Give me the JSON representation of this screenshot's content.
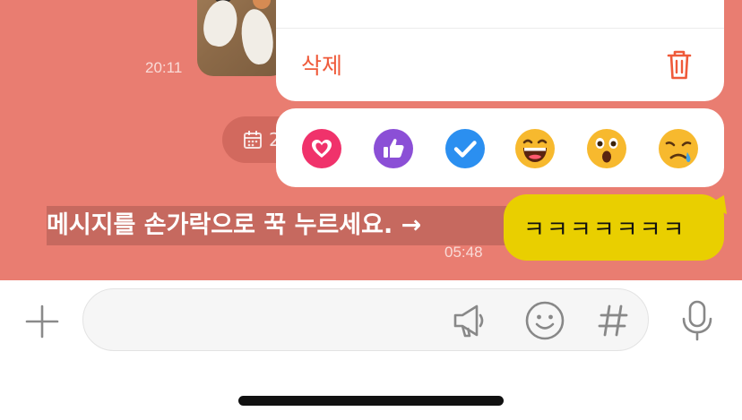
{
  "chat": {
    "time_photo": "20:11",
    "time_bubble": "05:48",
    "date_chip_visible": "2"
  },
  "context_menu": {
    "delete_label": "삭제",
    "delete_icon": "trash-icon",
    "accent": "#ef5a3a"
  },
  "reactions": [
    {
      "name": "heart-reaction-icon",
      "color": "#f0326b"
    },
    {
      "name": "thumbs-up-reaction-icon",
      "color": "#8b4fd6"
    },
    {
      "name": "check-reaction-icon",
      "color": "#2b8ff0"
    },
    {
      "name": "grin-emoji-icon",
      "color": "#f7b92e"
    },
    {
      "name": "surprised-emoji-icon",
      "color": "#f7b92e"
    },
    {
      "name": "sad-emoji-icon",
      "color": "#f7b92e"
    }
  ],
  "tutorial": {
    "text": "메시지를 손가락으로 꾹 누르세요.",
    "arrow": "→"
  },
  "message": {
    "text": "ㅋㅋㅋㅋㅋㅋㅋ",
    "bubble_color": "#e9cf00"
  },
  "input_bar": {
    "placeholder": "",
    "icons": [
      "plus-icon",
      "megaphone-icon",
      "emoji-icon",
      "hashtag-icon",
      "microphone-icon"
    ]
  },
  "colors": {
    "chat_background": "#e97d71"
  }
}
